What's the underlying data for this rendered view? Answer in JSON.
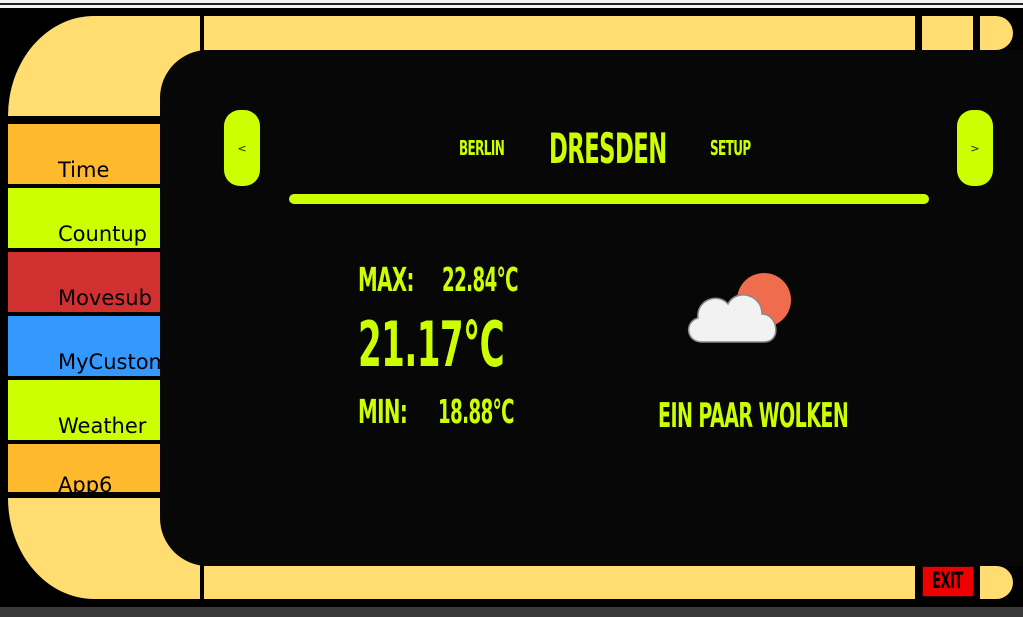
{
  "window": {
    "title": ""
  },
  "sidebar": {
    "items": [
      {
        "label": "Time",
        "color": "#ffb92c"
      },
      {
        "label": "Countup",
        "color": "#ccff00"
      },
      {
        "label": "Movesub",
        "color": "#d03030"
      },
      {
        "label": "MyCustom",
        "color": "#3399ff"
      },
      {
        "label": "Weather",
        "color": "#ccff00"
      },
      {
        "label": "App6",
        "color": "#ffb92c"
      }
    ]
  },
  "nav": {
    "prev_label": "<",
    "next_label": ">",
    "tabs": [
      "BERLIN",
      "DRESDEN",
      "SETUP"
    ],
    "active_tab": "DRESDEN"
  },
  "weather": {
    "max_label": "MAX:",
    "max_value": "22.84°C",
    "current": "21.17°C",
    "min_label": "MIN:",
    "min_value": "18.88°C",
    "condition": "EIN PAAR WOLKEN",
    "icon": "partly-cloudy-icon"
  },
  "exit_label": "EXIT",
  "colors": {
    "frame": "#ffdd70",
    "accent": "#ccff00",
    "panel": "#070707",
    "exit": "#ee0000",
    "sun": "#ef6c4c",
    "cloud": "#f2f2f2"
  }
}
